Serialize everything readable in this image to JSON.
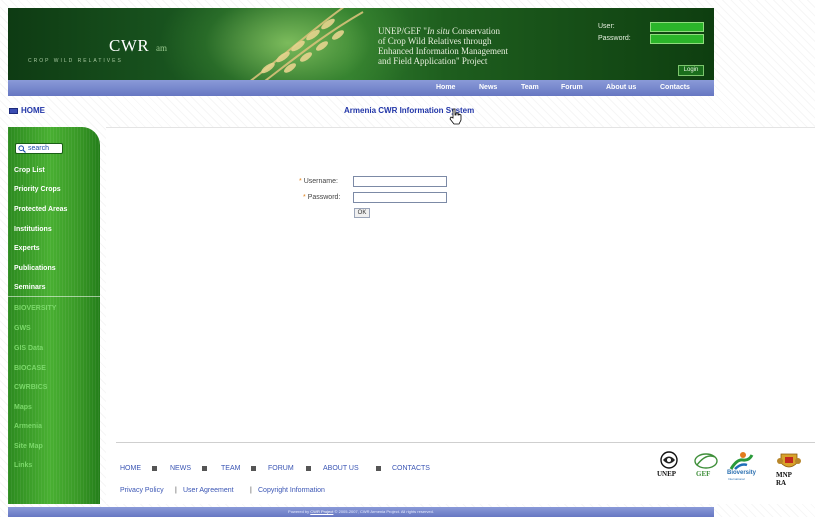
{
  "header": {
    "logo_text": "CWR",
    "logo_suffix": "am",
    "logo_tagline": "CROP WILD RELATIVES",
    "project_title_prefix": "UNEP/GEF \"",
    "project_title_emphasis": "In situ",
    "project_title_rest_1": " Conservation",
    "project_title_line_2": "of Crop Wild Relatives through",
    "project_title_line_3": "Enhanced Information Management",
    "project_title_line_4": "and Field Application\" Project",
    "user_label": "User:",
    "password_label": "Password:",
    "login_button": "Login"
  },
  "nav": {
    "items": [
      "Home",
      "News",
      "Team",
      "Forum",
      "About us",
      "Contacts"
    ]
  },
  "breadcrumb": {
    "label": "HOME"
  },
  "page_title": "Armenia CWR Information System",
  "sidebar": {
    "search_label": "search",
    "primary_items": [
      "Crop List",
      "Priority Crops",
      "Protected Areas",
      "Institutions",
      "Experts",
      "Publications",
      "Seminars"
    ],
    "secondary_items": [
      "BIOVERSITY",
      "GWS",
      "GIS Data",
      "BIOCASE",
      "CWRBICS",
      "Maps",
      "Armenia",
      "Site Map",
      "Links"
    ]
  },
  "login_form": {
    "required_marker": "*",
    "username_label": "Username:",
    "password_label": "Password:",
    "username_value": "",
    "password_value": "",
    "ok_button": "OK"
  },
  "footer": {
    "links": [
      "HOME",
      "NEWS",
      "TEAM",
      "FORUM",
      "ABOUT US",
      "CONTACTS"
    ],
    "legal_links": [
      "Privacy Policy",
      "User Agreement",
      "Copyright Information"
    ],
    "legal_separator": "|",
    "partners": [
      "UNEP",
      "GEF",
      "Bioversity",
      "MNP RA"
    ],
    "bioversity_sub": "International",
    "powered_by_prefix": "Powered by",
    "powered_by_link": "CWR Project",
    "powered_by_suffix": "© 2005-2007, CWR Armenia Project. All rights reserved."
  },
  "colors": {
    "nav_bar": "#7585cc",
    "sidebar_green": "#3ea82a",
    "banner_green": "#1c5b22",
    "link_blue": "#2236a8"
  }
}
